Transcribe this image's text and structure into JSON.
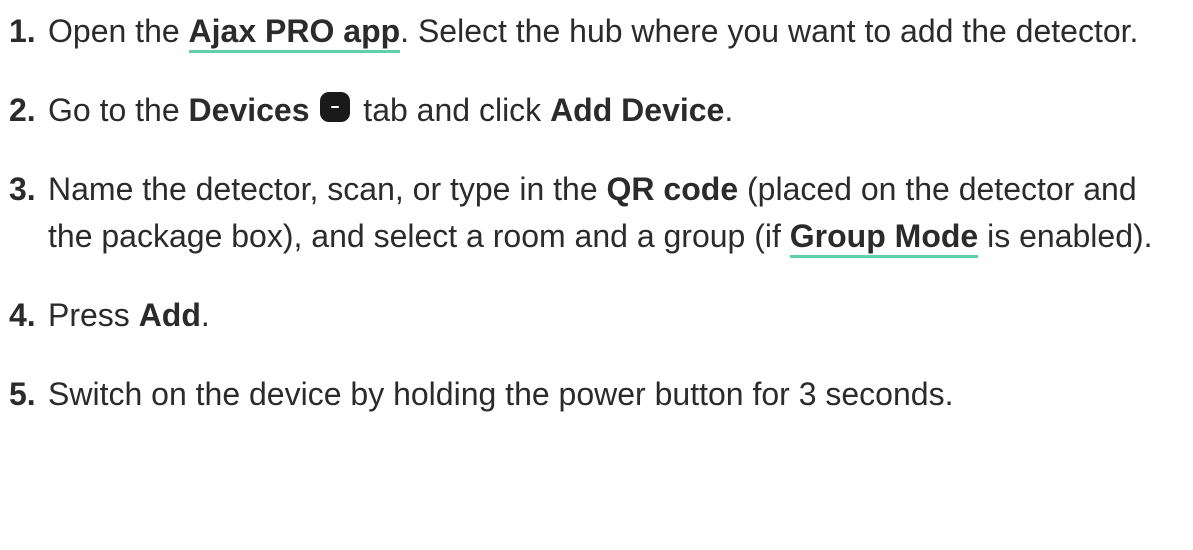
{
  "steps": [
    {
      "num": "1.",
      "t1": "Open the ",
      "link": "Ajax PRO app",
      "t2": ". Select the hub where you want to add the detector."
    },
    {
      "num": "2.",
      "t1": "Go to the ",
      "b1": "Devices",
      "icon": "devices-icon",
      "t2": " tab and click ",
      "b2": "Add Device",
      "t3": "."
    },
    {
      "num": "3.",
      "t1": "Name the detector, scan, or type in the ",
      "b1": "QR code",
      "t2": " (placed on the detector and the package box), and select a room and a group (if ",
      "link": "Group Mode",
      "t3": " is enabled)."
    },
    {
      "num": "4.",
      "t1": "Press ",
      "b1": "Add",
      "t2": "."
    },
    {
      "num": "5.",
      "t1": "Switch on the device by holding the power button for 3 seconds."
    }
  ],
  "colors": {
    "text": "#2b2b2b",
    "link_underline": "#5fd0a8",
    "icon_bg": "#1a1a1a"
  }
}
